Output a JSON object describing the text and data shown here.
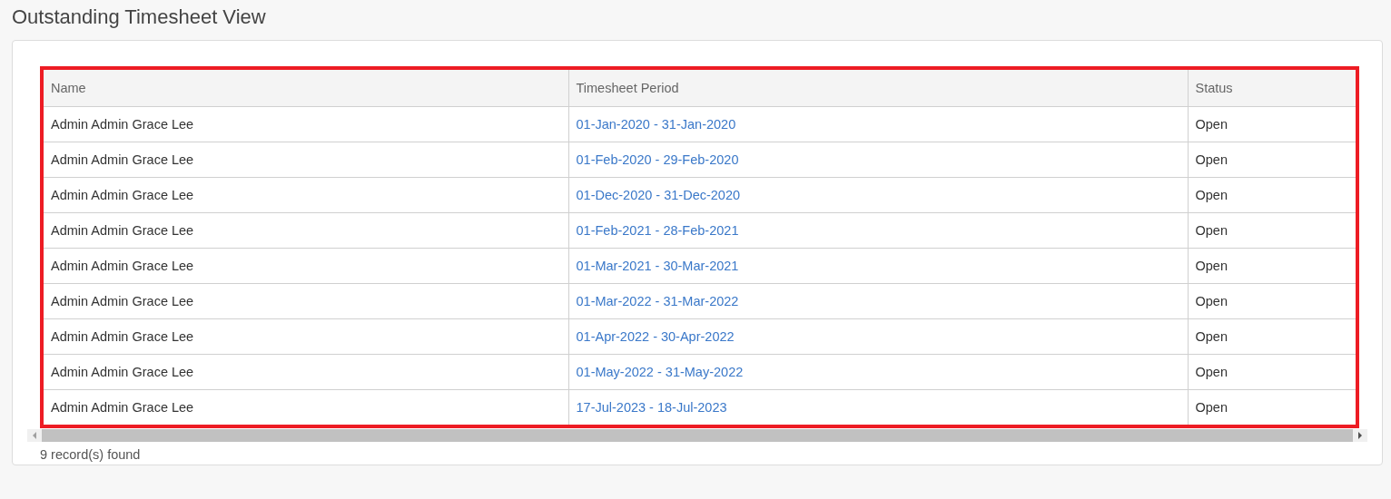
{
  "page_title": "Outstanding Timesheet View",
  "table": {
    "columns": [
      "Name",
      "Timesheet Period",
      "Status"
    ],
    "rows": [
      {
        "name": "Admin Admin Grace Lee",
        "period": "01-Jan-2020 - 31-Jan-2020",
        "status": "Open"
      },
      {
        "name": "Admin Admin Grace Lee",
        "period": "01-Feb-2020 - 29-Feb-2020",
        "status": "Open"
      },
      {
        "name": "Admin Admin Grace Lee",
        "period": "01-Dec-2020 - 31-Dec-2020",
        "status": "Open"
      },
      {
        "name": "Admin Admin Grace Lee",
        "period": "01-Feb-2021 - 28-Feb-2021",
        "status": "Open"
      },
      {
        "name": "Admin Admin Grace Lee",
        "period": "01-Mar-2021 - 30-Mar-2021",
        "status": "Open"
      },
      {
        "name": "Admin Admin Grace Lee",
        "period": "01-Mar-2022 - 31-Mar-2022",
        "status": "Open"
      },
      {
        "name": "Admin Admin Grace Lee",
        "period": "01-Apr-2022 - 30-Apr-2022",
        "status": "Open"
      },
      {
        "name": "Admin Admin Grace Lee",
        "period": "01-May-2022 - 31-May-2022",
        "status": "Open"
      },
      {
        "name": "Admin Admin Grace Lee",
        "period": "17-Jul-2023 - 18-Jul-2023",
        "status": "Open"
      }
    ]
  },
  "record_count": "9 record(s) found"
}
